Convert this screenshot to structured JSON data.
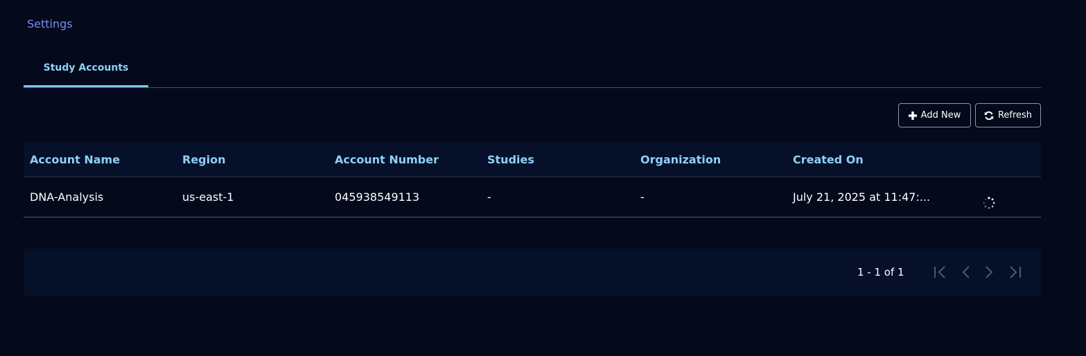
{
  "breadcrumb": {
    "label": "Settings"
  },
  "tabs": [
    {
      "label": "Study Accounts",
      "active": true
    }
  ],
  "toolbar": {
    "add_label": "Add New",
    "refresh_label": "Refresh"
  },
  "table": {
    "columns": [
      "Account Name",
      "Region",
      "Account Number",
      "Studies",
      "Organization",
      "Created On"
    ],
    "rows": [
      {
        "account_name": "DNA-Analysis",
        "region": "us-east-1",
        "account_number": "045938549113",
        "studies": "-",
        "organization": "-",
        "created_on": "July 21, 2025 at 11:47:...",
        "status_icon": "loading-spinner-icon"
      }
    ]
  },
  "pagination": {
    "range": "1 - 1 of 1"
  },
  "colors": {
    "background": "#040a1b",
    "header_bg": "#061029",
    "accent": "#8fd0f6",
    "link": "#7b8cf2"
  }
}
